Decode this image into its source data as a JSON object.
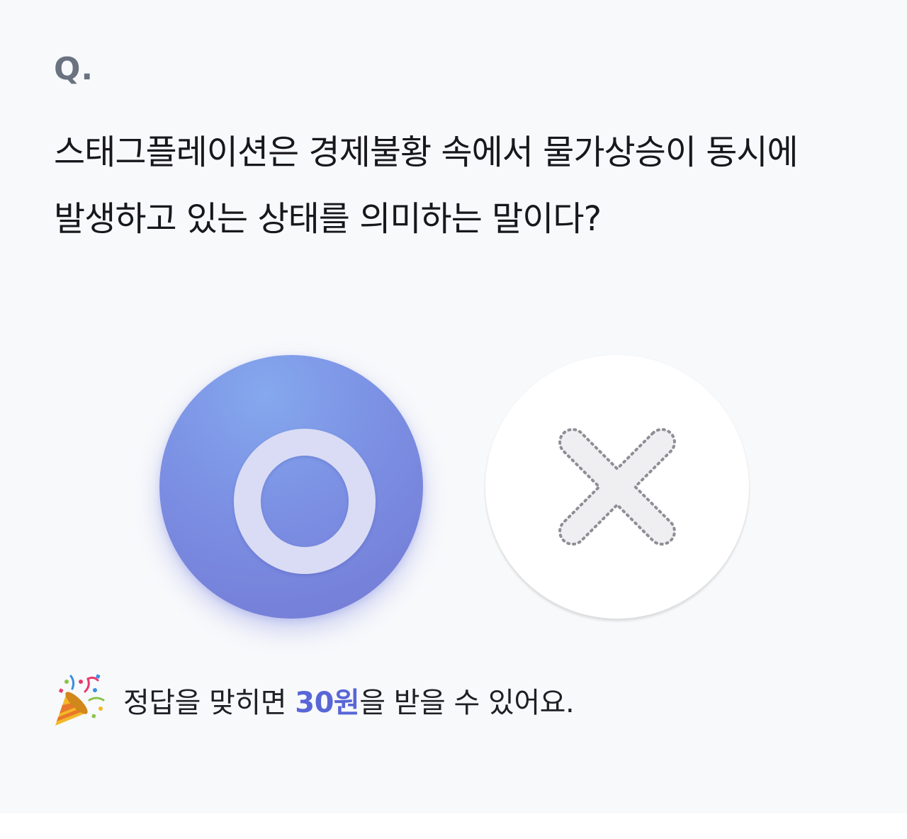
{
  "quiz": {
    "q_label": "Q.",
    "question": "스태그플레이션은 경제불황 속에서 물가상승이 동시에 발생하고 있는 상태를 의미하는 말이다?",
    "choices": {
      "o": {
        "icon": "o-icon",
        "label": "O"
      },
      "x": {
        "icon": "x-icon",
        "label": "X"
      }
    },
    "reward": {
      "icon": "party-popper-icon",
      "prefix": "정답을 맞히면 ",
      "amount": "30원",
      "suffix": "을 받을 수 있어요."
    }
  },
  "colors": {
    "background": "#f8f9fb",
    "o_button": "#7b8fe3",
    "o_ring": "#d9dcf4",
    "x_button": "#ffffff",
    "amount": "#5866d6",
    "q_label": "#6b7280",
    "text": "#17171c"
  }
}
